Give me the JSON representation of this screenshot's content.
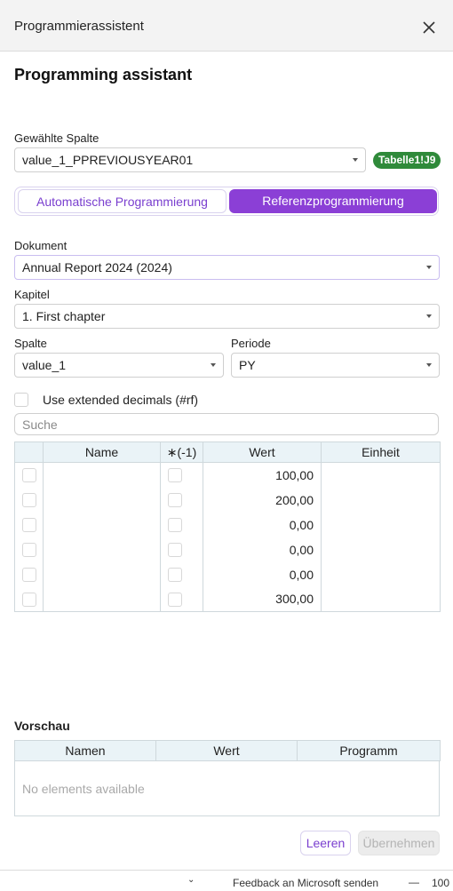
{
  "window": {
    "title": "Programmierassistent",
    "close_icon": "close-icon"
  },
  "page_title": "Programming assistant",
  "column": {
    "label": "Gewählte Spalte",
    "value": "value_1_PPREVIOUSYEAR01",
    "badge": "Tabelle1!J9",
    "badge_color": "#2f8a3a"
  },
  "mode_toggle": {
    "options": [
      "Automatische Programmierung",
      "Referenzprogrammierung"
    ],
    "selected": "Referenzprogrammierung",
    "accent": "#8b3fd6"
  },
  "document": {
    "label": "Dokument",
    "value": "Annual Report 2024 (2024)"
  },
  "chapter": {
    "label": "Kapitel",
    "value": "1. First chapter"
  },
  "column_select": {
    "label": "Spalte",
    "value": "value_1"
  },
  "period": {
    "label": "Periode",
    "value": "PY"
  },
  "extended_decimals": {
    "label": "Use extended decimals (#rf)",
    "checked": false
  },
  "search": {
    "placeholder": "Suche"
  },
  "table": {
    "headers": [
      "",
      "Name",
      "∗(-1)",
      "Wert",
      "Einheit"
    ],
    "rows": [
      {
        "name": "",
        "value": "100,00",
        "unit": ""
      },
      {
        "name": "",
        "value": "200,00",
        "unit": ""
      },
      {
        "name": "",
        "value": "0,00",
        "unit": ""
      },
      {
        "name": "",
        "value": "0,00",
        "unit": ""
      },
      {
        "name": "",
        "value": "0,00",
        "unit": ""
      },
      {
        "name": "",
        "value": "300,00",
        "unit": ""
      }
    ]
  },
  "preview": {
    "title": "Vorschau",
    "headers": [
      "Namen",
      "Wert",
      "Programm"
    ],
    "empty_text": "No elements available"
  },
  "buttons": {
    "clear": "Leeren",
    "apply": "Übernehmen"
  },
  "statusbar": {
    "feedback": "Feedback an Microsoft senden",
    "zoom": "100 %"
  }
}
